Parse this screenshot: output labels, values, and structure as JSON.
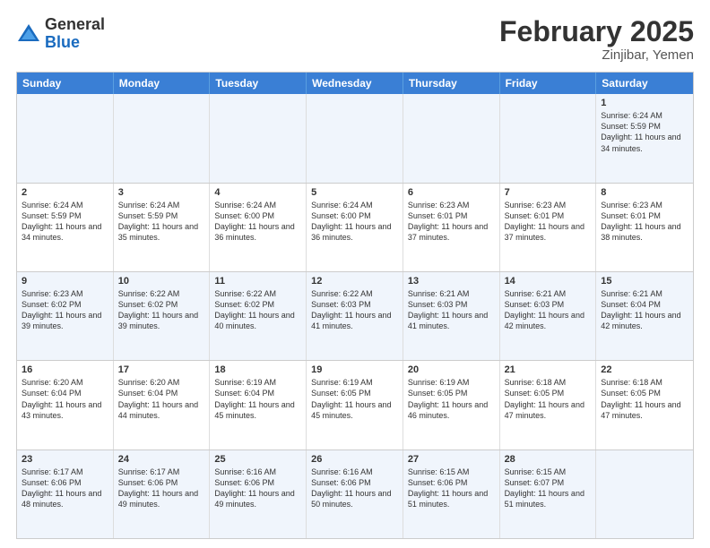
{
  "logo": {
    "general": "General",
    "blue": "Blue"
  },
  "title": "February 2025",
  "location": "Zinjibar, Yemen",
  "header_days": [
    "Sunday",
    "Monday",
    "Tuesday",
    "Wednesday",
    "Thursday",
    "Friday",
    "Saturday"
  ],
  "rows": [
    [
      {
        "day": "",
        "text": ""
      },
      {
        "day": "",
        "text": ""
      },
      {
        "day": "",
        "text": ""
      },
      {
        "day": "",
        "text": ""
      },
      {
        "day": "",
        "text": ""
      },
      {
        "day": "",
        "text": ""
      },
      {
        "day": "1",
        "text": "Sunrise: 6:24 AM\nSunset: 5:59 PM\nDaylight: 11 hours and 34 minutes."
      }
    ],
    [
      {
        "day": "2",
        "text": "Sunrise: 6:24 AM\nSunset: 5:59 PM\nDaylight: 11 hours and 34 minutes."
      },
      {
        "day": "3",
        "text": "Sunrise: 6:24 AM\nSunset: 5:59 PM\nDaylight: 11 hours and 35 minutes."
      },
      {
        "day": "4",
        "text": "Sunrise: 6:24 AM\nSunset: 6:00 PM\nDaylight: 11 hours and 36 minutes."
      },
      {
        "day": "5",
        "text": "Sunrise: 6:24 AM\nSunset: 6:00 PM\nDaylight: 11 hours and 36 minutes."
      },
      {
        "day": "6",
        "text": "Sunrise: 6:23 AM\nSunset: 6:01 PM\nDaylight: 11 hours and 37 minutes."
      },
      {
        "day": "7",
        "text": "Sunrise: 6:23 AM\nSunset: 6:01 PM\nDaylight: 11 hours and 37 minutes."
      },
      {
        "day": "8",
        "text": "Sunrise: 6:23 AM\nSunset: 6:01 PM\nDaylight: 11 hours and 38 minutes."
      }
    ],
    [
      {
        "day": "9",
        "text": "Sunrise: 6:23 AM\nSunset: 6:02 PM\nDaylight: 11 hours and 39 minutes."
      },
      {
        "day": "10",
        "text": "Sunrise: 6:22 AM\nSunset: 6:02 PM\nDaylight: 11 hours and 39 minutes."
      },
      {
        "day": "11",
        "text": "Sunrise: 6:22 AM\nSunset: 6:02 PM\nDaylight: 11 hours and 40 minutes."
      },
      {
        "day": "12",
        "text": "Sunrise: 6:22 AM\nSunset: 6:03 PM\nDaylight: 11 hours and 41 minutes."
      },
      {
        "day": "13",
        "text": "Sunrise: 6:21 AM\nSunset: 6:03 PM\nDaylight: 11 hours and 41 minutes."
      },
      {
        "day": "14",
        "text": "Sunrise: 6:21 AM\nSunset: 6:03 PM\nDaylight: 11 hours and 42 minutes."
      },
      {
        "day": "15",
        "text": "Sunrise: 6:21 AM\nSunset: 6:04 PM\nDaylight: 11 hours and 42 minutes."
      }
    ],
    [
      {
        "day": "16",
        "text": "Sunrise: 6:20 AM\nSunset: 6:04 PM\nDaylight: 11 hours and 43 minutes."
      },
      {
        "day": "17",
        "text": "Sunrise: 6:20 AM\nSunset: 6:04 PM\nDaylight: 11 hours and 44 minutes."
      },
      {
        "day": "18",
        "text": "Sunrise: 6:19 AM\nSunset: 6:04 PM\nDaylight: 11 hours and 45 minutes."
      },
      {
        "day": "19",
        "text": "Sunrise: 6:19 AM\nSunset: 6:05 PM\nDaylight: 11 hours and 45 minutes."
      },
      {
        "day": "20",
        "text": "Sunrise: 6:19 AM\nSunset: 6:05 PM\nDaylight: 11 hours and 46 minutes."
      },
      {
        "day": "21",
        "text": "Sunrise: 6:18 AM\nSunset: 6:05 PM\nDaylight: 11 hours and 47 minutes."
      },
      {
        "day": "22",
        "text": "Sunrise: 6:18 AM\nSunset: 6:05 PM\nDaylight: 11 hours and 47 minutes."
      }
    ],
    [
      {
        "day": "23",
        "text": "Sunrise: 6:17 AM\nSunset: 6:06 PM\nDaylight: 11 hours and 48 minutes."
      },
      {
        "day": "24",
        "text": "Sunrise: 6:17 AM\nSunset: 6:06 PM\nDaylight: 11 hours and 49 minutes."
      },
      {
        "day": "25",
        "text": "Sunrise: 6:16 AM\nSunset: 6:06 PM\nDaylight: 11 hours and 49 minutes."
      },
      {
        "day": "26",
        "text": "Sunrise: 6:16 AM\nSunset: 6:06 PM\nDaylight: 11 hours and 50 minutes."
      },
      {
        "day": "27",
        "text": "Sunrise: 6:15 AM\nSunset: 6:06 PM\nDaylight: 11 hours and 51 minutes."
      },
      {
        "day": "28",
        "text": "Sunrise: 6:15 AM\nSunset: 6:07 PM\nDaylight: 11 hours and 51 minutes."
      },
      {
        "day": "",
        "text": ""
      }
    ]
  ]
}
